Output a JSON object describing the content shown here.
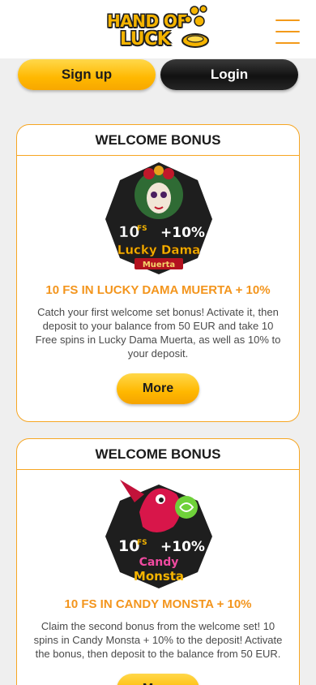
{
  "header": {
    "logo_line1": "HAND OF",
    "logo_line2": "LUCK",
    "menu_icon": "hamburger-menu-icon"
  },
  "auth": {
    "signup_label": "Sign up",
    "login_label": "Login"
  },
  "bonuses": [
    {
      "heading": "WELCOME BONUS",
      "image": {
        "line1": "10",
        "fs": "FS",
        "plus": "+10%",
        "game_line1": "Lucky Dama",
        "game_line2": "Muerta"
      },
      "title": "10 FS IN LUCKY DAMA MUERTA + 10%",
      "description": "Catch your first welcome set bonus! Activate it, then deposit to your balance from 50 EUR and take 10 Free spins in Lucky Dama Muerta, as well as 10% to your deposit.",
      "button_label": "More"
    },
    {
      "heading": "WELCOME BONUS",
      "image": {
        "line1": "10",
        "fs": "FS",
        "plus": "+10%",
        "game_line1": "Candy",
        "game_line2": "Monsta"
      },
      "title": "10 FS IN CANDY MONSTA + 10%",
      "description": "Claim the second bonus from the welcome set! 10 spins in Candy Monsta + 10% to the deposit! Activate the bonus, then deposit to the balance from 50 EUR.",
      "button_label": "More"
    }
  ],
  "colors": {
    "accent_orange": "#f3951d",
    "button_yellow": "#ffb800",
    "card_border": "#f6a623",
    "page_bg": "#efefef"
  }
}
